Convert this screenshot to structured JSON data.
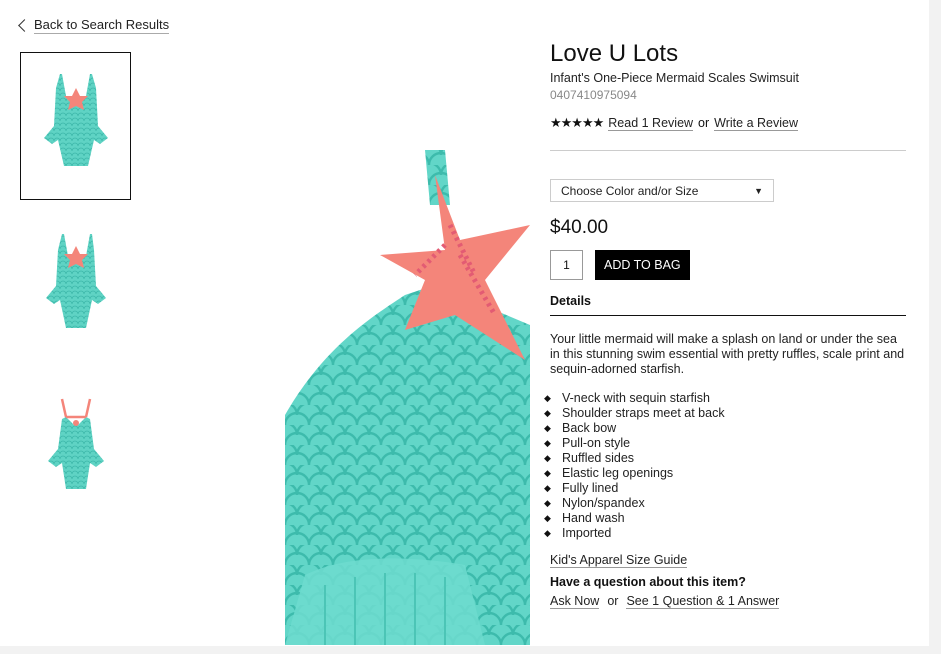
{
  "nav": {
    "back_label": "Back to Search Results"
  },
  "thumbnails": [
    {
      "name": "thumbnail-front",
      "selected": true
    },
    {
      "name": "thumbnail-side",
      "selected": false
    },
    {
      "name": "thumbnail-back",
      "selected": false
    }
  ],
  "product": {
    "brand": "Love U Lots",
    "name": "Infant's One-Piece Mermaid Scales Swimsuit",
    "sku": "0407410975094",
    "stars": "★★★★★",
    "review_link": "Read 1 Review",
    "review_or": "or",
    "write_review": "Write a Review",
    "select_placeholder": "Choose Color and/or Size",
    "price": "$40.00",
    "quantity": "1",
    "add_to_bag": "ADD TO BAG"
  },
  "details": {
    "heading": "Details",
    "description": "Your little mermaid will make a splash on land or under the sea in this stunning swim essential with pretty ruffles, scale print and sequin-adorned starfish.",
    "features": [
      "V-neck with sequin starfish",
      "Shoulder straps meet at back",
      "Back bow",
      "Pull-on style",
      "Ruffled sides",
      "Elastic leg openings",
      "Fully lined",
      "Nylon/spandex",
      "Hand wash",
      "Imported"
    ],
    "size_guide": "Kid's Apparel Size Guide",
    "question": "Have a question about this item?",
    "ask_now": "Ask Now",
    "ask_or": "or",
    "see_answers": "See 1 Question & 1 Answer"
  },
  "colors": {
    "aqua": "#57d1c2",
    "coral": "#f4857a"
  }
}
